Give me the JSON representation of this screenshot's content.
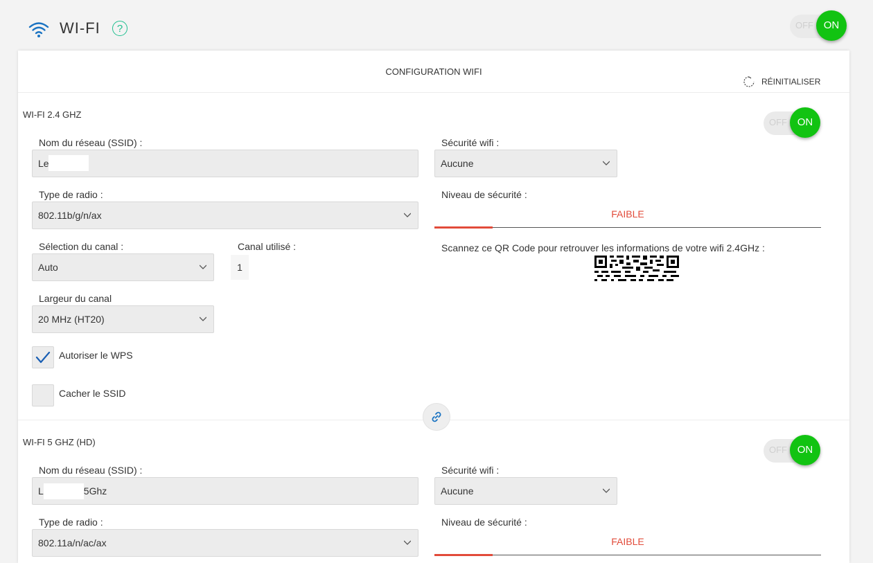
{
  "header": {
    "title": "WI-FI",
    "help_label": "?",
    "master_toggle": {
      "off_label": "OFF",
      "on_label": "ON"
    }
  },
  "card": {
    "title": "CONFIGURATION WIFI",
    "reset_label": "RÉINITIALISER",
    "link_icon": "link-icon"
  },
  "wifi24": {
    "section_title": "WI-FI 2.4 GHZ",
    "toggle": {
      "off_label": "OFF",
      "on_label": "ON"
    },
    "ssid_label": "Nom du réseau (SSID) :",
    "ssid_value": "Le",
    "radio_label": "Type de radio :",
    "radio_value": "802.11b/g/n/ax",
    "channel_sel_label": "Sélection du canal :",
    "channel_sel_value": "Auto",
    "channel_used_label": "Canal utilisé :",
    "channel_used_value": "1",
    "width_label": "Largeur du canal",
    "width_value": "20 MHz (HT20)",
    "wps_label": "Autoriser le WPS",
    "wps_checked": true,
    "hide_ssid_label": "Cacher le SSID",
    "hide_ssid_checked": false,
    "security_label": "Sécurité wifi :",
    "security_value": "Aucune",
    "sec_level_label": "Niveau de sécurité :",
    "sec_level_value": "FAIBLE",
    "sec_level_fraction": 0.15,
    "qr_label": "Scannez ce QR Code pour retrouver les informations de votre wifi 2.4GHz :"
  },
  "wifi5": {
    "section_title": "WI-FI 5 GHZ (HD)",
    "toggle": {
      "off_label": "OFF",
      "on_label": "ON"
    },
    "ssid_label": "Nom du réseau (SSID) :",
    "ssid_prefix": "L",
    "ssid_suffix": "5Ghz",
    "radio_label": "Type de radio :",
    "radio_value": "802.11a/n/ac/ax",
    "security_label": "Sécurité wifi :",
    "security_value": "Aucune",
    "sec_level_label": "Niveau de sécurité :",
    "sec_level_value": "FAIBLE",
    "sec_level_fraction": 0.15
  },
  "colors": {
    "accent_green": "#12c312",
    "help_teal": "#1fbf8f",
    "wifi_blue": "#1a73c2",
    "danger_red": "#e24b3a",
    "check_blue": "#1a5fb4"
  }
}
